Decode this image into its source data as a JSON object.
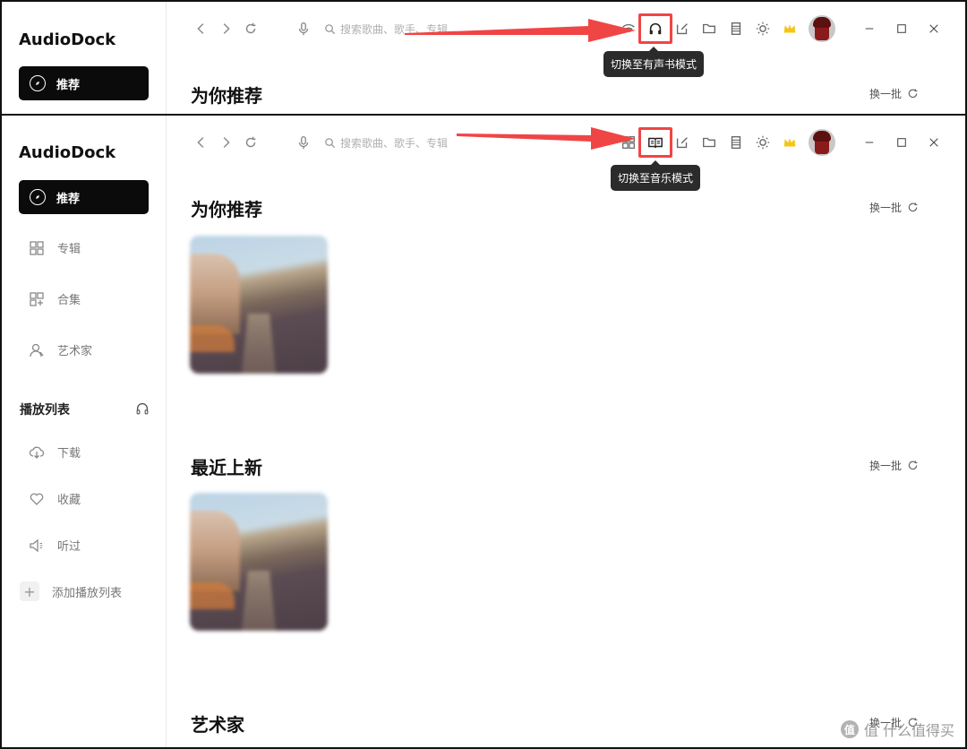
{
  "app": {
    "title": "AudioDock"
  },
  "search": {
    "placeholder": "搜索歌曲、歌手、专辑"
  },
  "top_panel": {
    "nav_active_label": "推荐",
    "section_title": "为你推荐",
    "refresh_label": "换一批",
    "tooltip": "切换至有声书模式",
    "highlight_icon": "headphones-icon"
  },
  "bottom_panel": {
    "nav_active_label": "推荐",
    "tooltip": "切换至音乐模式",
    "highlight_icon": "book-icon",
    "sidebar": {
      "items": [
        {
          "label": "专辑",
          "icon": "grid-icon"
        },
        {
          "label": "合集",
          "icon": "collection-icon"
        },
        {
          "label": "艺术家",
          "icon": "artist-icon"
        }
      ],
      "playlist_header": "播放列表",
      "playlist_items": [
        {
          "label": "下载",
          "icon": "cloud-download-icon"
        },
        {
          "label": "收藏",
          "icon": "heart-icon"
        },
        {
          "label": "听过",
          "icon": "speaker-icon"
        }
      ],
      "add_playlist": "添加播放列表"
    },
    "sections": [
      {
        "title": "为你推荐",
        "refresh": "换一批",
        "album_title": "",
        "album_artist": ""
      },
      {
        "title": "最近上新",
        "refresh": "换一批",
        "album_title": "",
        "album_artist": ""
      },
      {
        "title": "艺术家",
        "refresh": "换一批"
      }
    ]
  },
  "toolbar_icons": [
    "back-icon",
    "forward-icon",
    "reload-icon",
    "mic-icon",
    "search-icon",
    "wifi-icon",
    "headphones-icon",
    "edit-icon",
    "folder-icon",
    "film-icon",
    "sun-icon",
    "crown-icon",
    "avatar",
    "minimize-icon",
    "maximize-icon",
    "close-icon"
  ],
  "watermark": {
    "text": "值 什么值得买"
  },
  "colors": {
    "highlight": "#f04545",
    "tooltip_bg": "#2b2b2b",
    "crown": "#f5c518",
    "active_nav_bg": "#0b0b0b"
  }
}
